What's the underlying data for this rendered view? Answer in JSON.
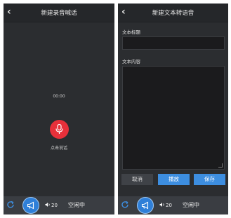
{
  "left_panel": {
    "title": "新建录音喊话",
    "timer": "00:00",
    "record_hint": "点击说话"
  },
  "right_panel": {
    "title": "新建文本转语音",
    "text_title_label": "文本标题",
    "text_content_label": "文本内容",
    "cancel_label": "取消",
    "play_label": "播放",
    "save_label": "保存"
  },
  "bottom_bar": {
    "volume": "20",
    "status": "空闲中"
  },
  "colors": {
    "panel_bg": "#2b2d30",
    "record_button": "#e8303a",
    "accent_blue": "#3d8ee0"
  }
}
